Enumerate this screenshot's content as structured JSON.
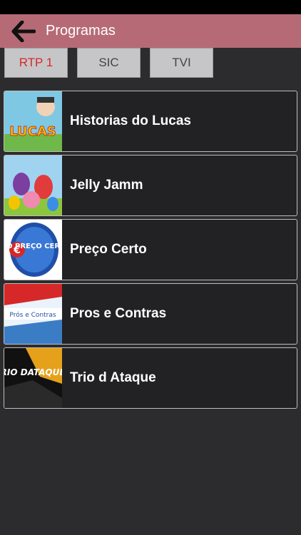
{
  "header": {
    "title": "Programas"
  },
  "tabs": [
    {
      "label": "RTP 1",
      "active": true
    },
    {
      "label": "SIC",
      "active": false
    },
    {
      "label": "TVI",
      "active": false
    }
  ],
  "programs": [
    {
      "title": "Historias do Lucas",
      "thumb_text": "LUCAS",
      "thumb_icon": "lucas-thumbnail"
    },
    {
      "title": "Jelly Jamm",
      "thumb_text": "",
      "thumb_icon": "jelly-jamm-thumbnail"
    },
    {
      "title": "Preço Certo",
      "thumb_text": "O PREÇO CERTO",
      "thumb_icon": "preco-certo-thumbnail"
    },
    {
      "title": "Pros e Contras",
      "thumb_text": "Prós e Contras",
      "thumb_icon": "pros-contras-thumbnail"
    },
    {
      "title": "Trio d Ataque",
      "thumb_text": "TRIO DATAQUE",
      "thumb_icon": "trio-dataque-thumbnail"
    }
  ],
  "colors": {
    "header_bg": "#b66a76",
    "active_tab_text": "#d62828",
    "body_bg": "#2c2c2e"
  }
}
